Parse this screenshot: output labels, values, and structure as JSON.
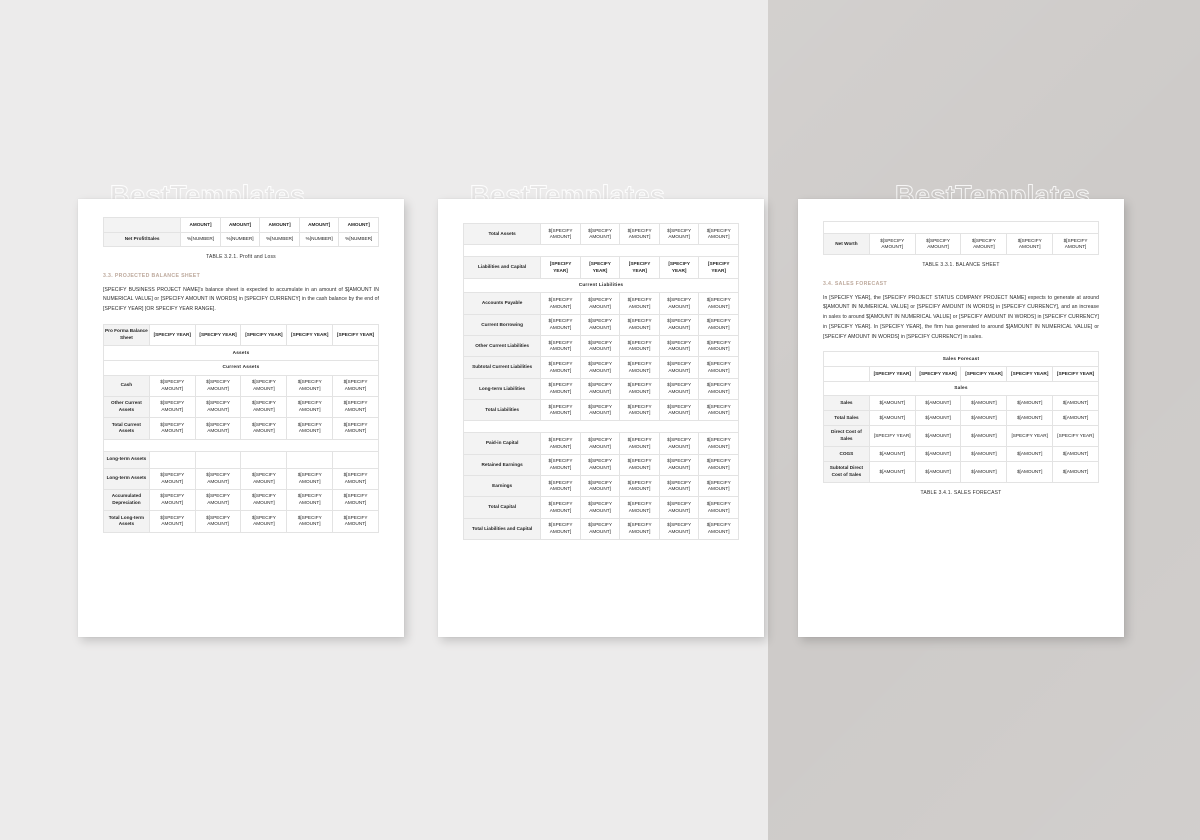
{
  "background": {
    "left_color": "#ecebeb",
    "right_color": "#cecbc9"
  },
  "watermark": {
    "text": "BestTemplates"
  },
  "common": {
    "specify_year": "[SPECIFY YEAR]",
    "specify_amount": "$[SPECIFY AMOUNT]",
    "amount": "$[AMOUNT]",
    "amount_head": "AMOUNT]",
    "number": "%[NUMBER]",
    "number_wrap": "%[NUMBER]",
    "blank": ""
  },
  "page1": {
    "profit_table": {
      "header": [
        "",
        "AMOUNT]",
        "AMOUNT]",
        "AMOUNT]",
        "AMOUNT]",
        "AMOUNT]"
      ],
      "rows": [
        {
          "label": "Net Profit/Sales",
          "values": [
            "%[NUMBER]",
            "%[NUMBER]",
            "%[NUMBER]",
            "%[NUMBER]",
            "%[NUMBER]"
          ]
        }
      ],
      "caption": "TABLE 3.2.1. Profit and Loss"
    },
    "section": {
      "heading": "3.3. PROJECTED BALANCE SHEET",
      "paragraph": "[SPECIFY  BUSINESS PROJECT NAME]'s  balance sheet is expected to accumulate in an amount of  $[AMOUNT IN NUMERICAL VALUE] or [SPECIFY AMOUNT IN WORDS] in [SPECIFY CURRENCY] in the cash balance by the end of [SPECIFY YEAR] [OR SPECIFY YEAR RANGE]."
    },
    "balance_table": {
      "header": [
        "Pro Forma Balance Sheet",
        "[SPECIFY YEAR]",
        "[SPECIFY YEAR]",
        "[SPECIFY YEAR]",
        "[SPECIFY YEAR]",
        "[SPECIFY YEAR]"
      ],
      "group1": "Assets",
      "group2": "Current Assets",
      "rows": [
        {
          "label": "Cash",
          "values": [
            "$[SPECIFY AMOUNT]",
            "$[SPECIFY AMOUNT]",
            "$[SPECIFY AMOUNT]",
            "$[SPECIFY AMOUNT]",
            "$[SPECIFY AMOUNT]"
          ]
        },
        {
          "label": "Other Current Assets",
          "values": [
            "$[SPECIFY AMOUNT]",
            "$[SPECIFY AMOUNT]",
            "$[SPECIFY AMOUNT]",
            "$[SPECIFY AMOUNT]",
            "$[SPECIFY AMOUNT]"
          ]
        },
        {
          "label": "Total Current Assets",
          "values": [
            "$[SPECIFY AMOUNT]",
            "$[SPECIFY AMOUNT]",
            "$[SPECIFY AMOUNT]",
            "$[SPECIFY AMOUNT]",
            "$[SPECIFY AMOUNT]"
          ]
        }
      ],
      "rows2": [
        {
          "label": "Long-term Assets",
          "values": [
            "",
            "",
            "",
            "",
            ""
          ]
        },
        {
          "label": "Long-term Assets",
          "values": [
            "$[SPECIFY AMOUNT]",
            "$[SPECIFY AMOUNT]",
            "$[SPECIFY AMOUNT]",
            "$[SPECIFY AMOUNT]",
            "$[SPECIFY AMOUNT]"
          ]
        },
        {
          "label": "Accumulated Depreciation",
          "values": [
            "$[SPECIFY AMOUNT]",
            "$[SPECIFY AMOUNT]",
            "$[SPECIFY AMOUNT]",
            "$[SPECIFY AMOUNT]",
            "$[SPECIFY AMOUNT]"
          ]
        },
        {
          "label": "Total Long-term Assets",
          "values": [
            "$[SPECIFY AMOUNT]",
            "$[SPECIFY AMOUNT]",
            "$[SPECIFY AMOUNT]",
            "$[SPECIFY AMOUNT]",
            "$[SPECIFY AMOUNT]"
          ]
        }
      ]
    }
  },
  "page2": {
    "balance_cont": {
      "rows_top": [
        {
          "label": "Total Assets",
          "values": [
            "$[SPECIFY AMOUNT]",
            "$[SPECIFY AMOUNT]",
            "$[SPECIFY AMOUNT]",
            "$[SPECIFY AMOUNT]",
            "$[SPECIFY AMOUNT]"
          ]
        }
      ],
      "liab_header": {
        "label": "Liabilities and Capital",
        "values": [
          "[SPECIFY YEAR]",
          "[SPECIFY YEAR]",
          "[SPECIFY YEAR]",
          "[SPECIFY YEAR]",
          "[SPECIFY YEAR]"
        ]
      },
      "group": "Current Liabilities",
      "rows_liab": [
        {
          "label": "Accounts Payable",
          "values": [
            "$[SPECIFY AMOUNT]",
            "$[SPECIFY AMOUNT]",
            "$[SPECIFY AMOUNT]",
            "$[SPECIFY AMOUNT]",
            "$[SPECIFY AMOUNT]"
          ]
        },
        {
          "label": "Current Borrowing",
          "values": [
            "$[SPECIFY AMOUNT]",
            "$[SPECIFY AMOUNT]",
            "$[SPECIFY AMOUNT]",
            "$[SPECIFY AMOUNT]",
            "$[SPECIFY AMOUNT]"
          ]
        },
        {
          "label": "Other Current Liabilities",
          "values": [
            "$[SPECIFY AMOUNT]",
            "$[SPECIFY AMOUNT]",
            "$[SPECIFY AMOUNT]",
            "$[SPECIFY AMOUNT]",
            "$[SPECIFY AMOUNT]"
          ]
        },
        {
          "label": "Subtotal Current Liabilities",
          "values": [
            "$[SPECIFY AMOUNT]",
            "$[SPECIFY AMOUNT]",
            "$[SPECIFY AMOUNT]",
            "$[SPECIFY AMOUNT]",
            "$[SPECIFY AMOUNT]"
          ]
        },
        {
          "label": "Long-term Liabilities",
          "values": [
            "$[SPECIFY AMOUNT]",
            "$[SPECIFY AMOUNT]",
            "$[SPECIFY AMOUNT]",
            "$[SPECIFY AMOUNT]",
            "$[SPECIFY AMOUNT]"
          ]
        },
        {
          "label": "Total Liabilities",
          "values": [
            "$[SPECIFY AMOUNT]",
            "$[SPECIFY AMOUNT]",
            "$[SPECIFY AMOUNT]",
            "$[SPECIFY AMOUNT]",
            "$[SPECIFY AMOUNT]"
          ]
        }
      ],
      "rows_cap": [
        {
          "label": "Paid-in Capital",
          "values": [
            "$[SPECIFY AMOUNT]",
            "$[SPECIFY AMOUNT]",
            "$[SPECIFY AMOUNT]",
            "$[SPECIFY AMOUNT]",
            "$[SPECIFY AMOUNT]"
          ]
        },
        {
          "label": "Retained Earnings",
          "values": [
            "$[SPECIFY AMOUNT]",
            "$[SPECIFY AMOUNT]",
            "$[SPECIFY AMOUNT]",
            "$[SPECIFY AMOUNT]",
            "$[SPECIFY AMOUNT]"
          ]
        },
        {
          "label": "Earnings",
          "values": [
            "$[SPECIFY AMOUNT]",
            "$[SPECIFY AMOUNT]",
            "$[SPECIFY AMOUNT]",
            "$[SPECIFY AMOUNT]",
            "$[SPECIFY AMOUNT]"
          ]
        },
        {
          "label": "Total Capital",
          "values": [
            "$[SPECIFY AMOUNT]",
            "$[SPECIFY AMOUNT]",
            "$[SPECIFY AMOUNT]",
            "$[SPECIFY AMOUNT]",
            "$[SPECIFY AMOUNT]"
          ]
        },
        {
          "label": "Total Liabilities and Capital",
          "values": [
            "$[SPECIFY AMOUNT]",
            "$[SPECIFY AMOUNT]",
            "$[SPECIFY AMOUNT]",
            "$[SPECIFY AMOUNT]",
            "$[SPECIFY AMOUNT]"
          ]
        }
      ]
    }
  },
  "page3": {
    "networth_table": {
      "rows": [
        {
          "label": "Net Worth",
          "values": [
            "$[SPECIFY AMOUNT]",
            "$[SPECIFY AMOUNT]",
            "$[SPECIFY AMOUNT]",
            "$[SPECIFY AMOUNT]",
            "$[SPECIFY AMOUNT]"
          ]
        }
      ],
      "caption": "TABLE 3.3.1. BALANCE SHEET"
    },
    "section": {
      "heading": "3.4. SALES FORECAST",
      "paragraph": "In [SPECIFY YEAR], the [SPECIFY PROJECT STATUS COMPANY PROJECT NAME] expects to generate at around $[AMOUNT IN NUMERICAL VALUE] or [SPECIFY AMOUNT IN WORDS] in [SPECIFY CURRENCY], and an increase in sales to around  $[AMOUNT IN NUMERICAL VALUE] or [SPECIFY AMOUNT IN WORDS] in [SPECIFY CURRENCY] in [SPECIFY YEAR]. In [SPECIFY YEAR], the firm has generated to around $[AMOUNT IN NUMERICAL VALUE] or [SPECIFY AMOUNT IN WORDS] in [SPECIFY CURRENCY] in sales."
    },
    "sales_table": {
      "title": "Sales Forecast",
      "header": [
        "",
        "[SPECIFY YEAR]",
        "[SPECIFY YEAR]",
        "[SPECIFY YEAR]",
        "[SPECIFY YEAR]",
        "[SPECIFY YEAR]"
      ],
      "group": "Sales",
      "rows": [
        {
          "label": "Sales",
          "values": [
            "$[AMOUNT]",
            "$[AMOUNT]",
            "$[AMOUNT]",
            "$[AMOUNT]",
            "$[AMOUNT]"
          ]
        },
        {
          "label": "Total Sales",
          "values": [
            "$[AMOUNT]",
            "$[AMOUNT]",
            "$[AMOUNT]",
            "$[AMOUNT]",
            "$[AMOUNT]"
          ]
        },
        {
          "label": "Direct Cost of Sales",
          "values": [
            "[SPECIFY YEAR]",
            "$[AMOUNT]",
            "$[AMOUNT]",
            "[SPECIFY YEAR]",
            "[SPECIFY YEAR]"
          ]
        },
        {
          "label": "COGS",
          "values": [
            "$[AMOUNT]",
            "$[AMOUNT]",
            "$[AMOUNT]",
            "$[AMOUNT]",
            "$[AMOUNT]"
          ]
        },
        {
          "label": "Subtotal Direct Cost of Sales",
          "values": [
            "$[AMOUNT]",
            "$[AMOUNT]",
            "$[AMOUNT]",
            "$[AMOUNT]",
            "$[AMOUNT]"
          ]
        }
      ],
      "caption": "TABLE 3.4.1. SALES FORECAST"
    }
  }
}
